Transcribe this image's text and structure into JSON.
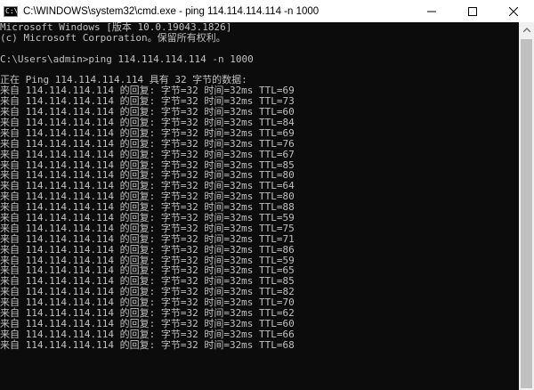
{
  "window": {
    "title": "C:\\WINDOWS\\system32\\cmd.exe - ping  114.114.114.114 -n 1000",
    "icon_text": "C:\\"
  },
  "controls": {
    "minimize_icon": "minimize-icon",
    "maximize_icon": "maximize-icon",
    "close_icon": "close-icon"
  },
  "console": {
    "lines": [
      "Microsoft Windows [版本 10.0.19043.1826]",
      "(c) Microsoft Corporation。保留所有权利。",
      "",
      "C:\\Users\\admin>ping 114.114.114.114 -n 1000",
      "",
      "正在 Ping 114.114.114.114 具有 32 字节的数据:",
      "来自 114.114.114.114 的回复: 字节=32 时间=32ms TTL=69",
      "来自 114.114.114.114 的回复: 字节=32 时间=32ms TTL=73",
      "来自 114.114.114.114 的回复: 字节=32 时间=32ms TTL=60",
      "来自 114.114.114.114 的回复: 字节=32 时间=32ms TTL=84",
      "来自 114.114.114.114 的回复: 字节=32 时间=32ms TTL=69",
      "来自 114.114.114.114 的回复: 字节=32 时间=32ms TTL=76",
      "来自 114.114.114.114 的回复: 字节=32 时间=32ms TTL=67",
      "来自 114.114.114.114 的回复: 字节=32 时间=32ms TTL=85",
      "来自 114.114.114.114 的回复: 字节=32 时间=32ms TTL=80",
      "来自 114.114.114.114 的回复: 字节=32 时间=32ms TTL=64",
      "来自 114.114.114.114 的回复: 字节=32 时间=32ms TTL=80",
      "来自 114.114.114.114 的回复: 字节=32 时间=32ms TTL=88",
      "来自 114.114.114.114 的回复: 字节=32 时间=32ms TTL=59",
      "来自 114.114.114.114 的回复: 字节=32 时间=32ms TTL=75",
      "来自 114.114.114.114 的回复: 字节=32 时间=32ms TTL=71",
      "来自 114.114.114.114 的回复: 字节=32 时间=32ms TTL=86",
      "来自 114.114.114.114 的回复: 字节=32 时间=32ms TTL=59",
      "来自 114.114.114.114 的回复: 字节=32 时间=32ms TTL=65",
      "来自 114.114.114.114 的回复: 字节=32 时间=32ms TTL=85",
      "来自 114.114.114.114 的回复: 字节=32 时间=32ms TTL=82",
      "来自 114.114.114.114 的回复: 字节=32 时间=32ms TTL=70",
      "来自 114.114.114.114 的回复: 字节=32 时间=32ms TTL=62",
      "来自 114.114.114.114 的回复: 字节=32 时间=32ms TTL=60",
      "来自 114.114.114.114 的回复: 字节=32 时间=32ms TTL=66",
      "来自 114.114.114.114 的回复: 字节=32 时间=32ms TTL=68"
    ]
  },
  "colors": {
    "console_bg": "#0c0c0c",
    "console_fg": "#c0c0c0",
    "titlebar_bg": "#ffffff",
    "scrollbar_bg": "#f0f0f0"
  }
}
